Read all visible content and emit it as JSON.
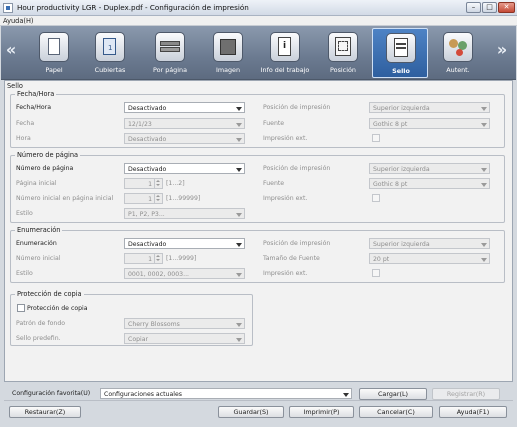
{
  "window": {
    "title": "Hour productivity LGR - Duplex.pdf - Configuración de impresión",
    "min": "–",
    "max": "□",
    "close": "✕"
  },
  "menu": {
    "help": "Ayuda(H)"
  },
  "toolbar": {
    "prev": "«",
    "next": "»",
    "items": [
      {
        "label": "Papel",
        "icon": "paper-icon"
      },
      {
        "label": "Cubiertas",
        "icon": "covers-icon"
      },
      {
        "label": "Por página",
        "icon": "per-page-icon"
      },
      {
        "label": "Imagen",
        "icon": "image-icon"
      },
      {
        "label": "Info del trabajo",
        "icon": "job-info-icon"
      },
      {
        "label": "Posición",
        "icon": "position-icon"
      },
      {
        "label": "Sello",
        "icon": "stamp-icon",
        "active": true
      },
      {
        "label": "Autent.",
        "icon": "authentication-icon"
      }
    ]
  },
  "stamp": {
    "title": "Sello",
    "datetime": {
      "title": "Fecha/Hora",
      "type_label": "Fecha/Hora",
      "type_value": "Desactivado",
      "date_label": "Fecha",
      "date_value": "12/1/23",
      "time_label": "Hora",
      "time_value": "Desactivado",
      "position_label": "Posición de impresión",
      "position_value": "Superior izquierda",
      "font_label": "Fuente",
      "font_value": "Gothic 8 pt",
      "ext_label": "Impresión ext."
    },
    "pagenum": {
      "title": "Número de página",
      "type_label": "Número de página",
      "type_value": "Desactivado",
      "start_label": "Página inicial",
      "start_value": "1",
      "start_range": "[1...2]",
      "startnum_label": "Número inicial en página inicial",
      "startnum_value": "1",
      "startnum_range": "[1...99999]",
      "style_label": "Estilo",
      "style_value": "P1, P2, P3...",
      "position_label": "Posición de impresión",
      "position_value": "Superior izquierda",
      "font_label": "Fuente",
      "font_value": "Gothic 8 pt",
      "ext_label": "Impresión ext."
    },
    "enum": {
      "title": "Enumeración",
      "type_label": "Enumeración",
      "type_value": "Desactivado",
      "start_label": "Número inicial",
      "start_value": "1",
      "start_range": "[1...9999]",
      "style_label": "Estilo",
      "style_value": "0001, 0002, 0003...",
      "position_label": "Posición de impresión",
      "position_value": "Superior izquierda",
      "fontsize_label": "Tamaño de Fuente",
      "fontsize_value": "20 pt",
      "ext_label": "Impresión ext."
    },
    "copyprot": {
      "title": "Protección de copia",
      "checkbox_label": "Protección de copia",
      "pattern_label": "Patrón de fondo",
      "pattern_value": "Cherry Blossoms",
      "preset_label": "Sello predefin.",
      "preset_value": "Copiar"
    }
  },
  "footer": {
    "favorite_label": "Configuración favorita(U)",
    "favorite_value": "Configuraciones actuales",
    "load": "Cargar(L)",
    "register": "Registrar(R)",
    "restore": "Restaurar(Z)",
    "save": "Guardar(S)",
    "print": "Imprimir(P)",
    "cancel": "Cancelar(C)",
    "help": "Ayuda(F1)"
  }
}
